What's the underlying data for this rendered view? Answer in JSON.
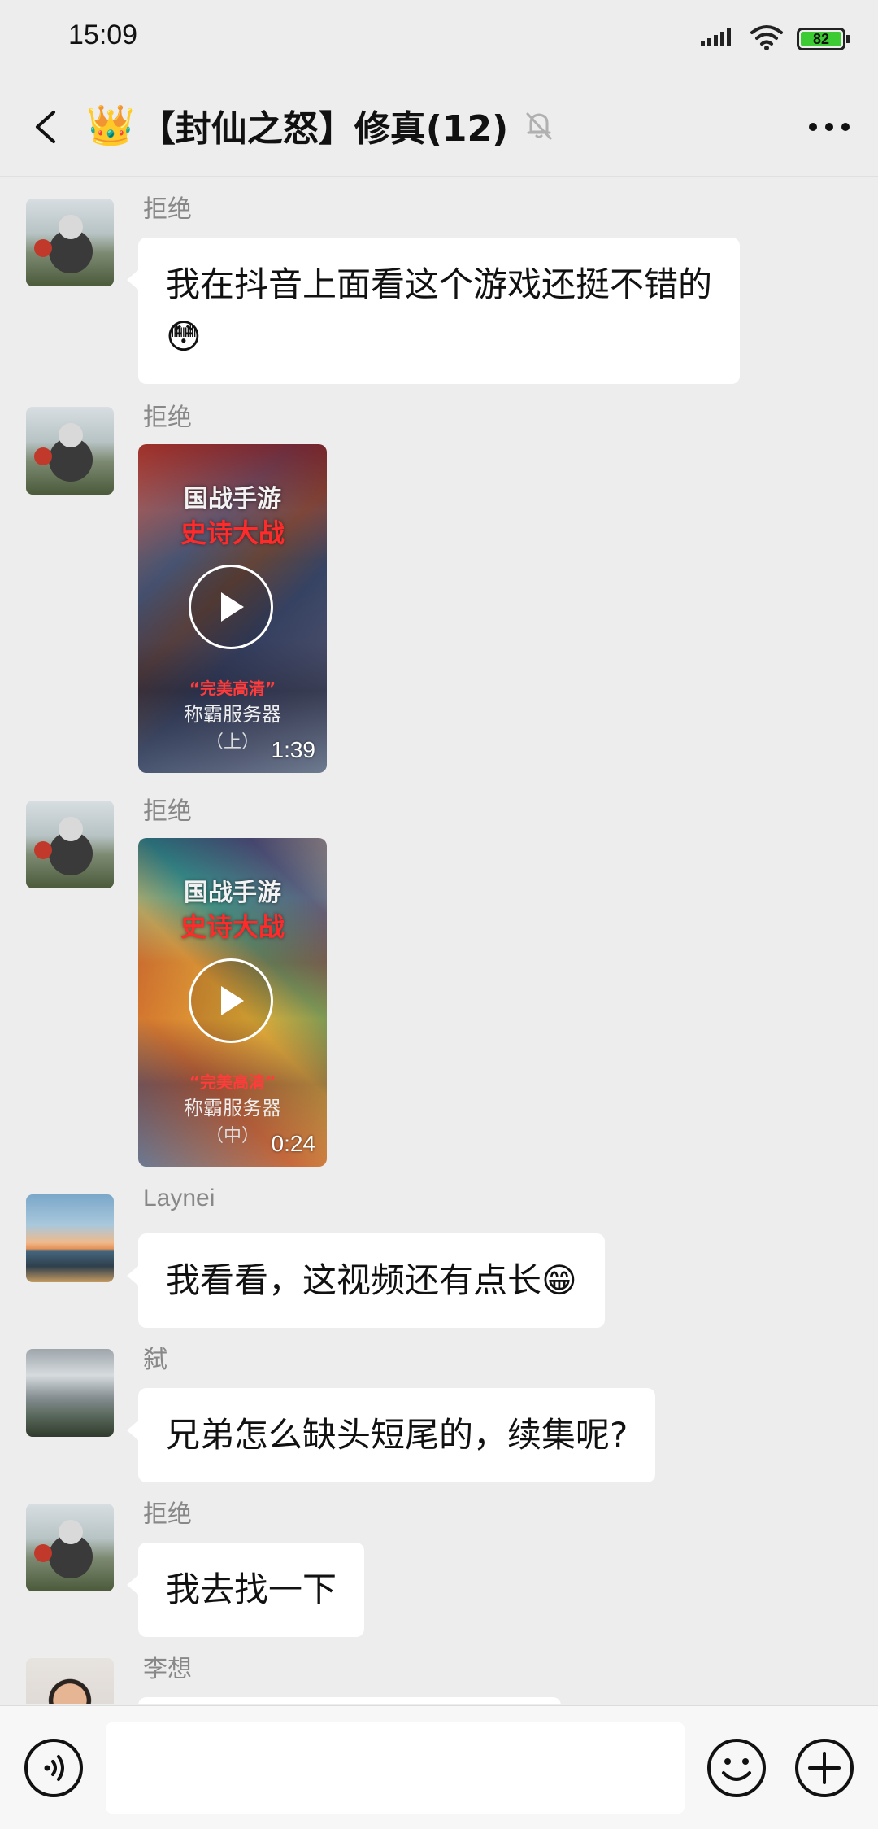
{
  "status_bar": {
    "time": "15:09",
    "battery": "82",
    "icons": [
      "signal-icon",
      "wifi-icon",
      "battery-icon"
    ]
  },
  "nav": {
    "crown_emoji": "👑",
    "title": "【封仙之怒】修真(12)",
    "icons": [
      "back-arrow-icon",
      "muted-bell-icon",
      "more-icon"
    ]
  },
  "messages": [
    {
      "sender": "拒绝",
      "type": "text",
      "text": "我在抖音上面看这个游戏还挺不错的😳"
    },
    {
      "sender": "拒绝",
      "type": "video",
      "video": {
        "title_line1": "国战手游",
        "title_line2": "史诗大战",
        "caption_line1": "“完美高清”",
        "caption_line2": "称霸服务器",
        "caption_line3": "（上）",
        "duration": "1:39"
      }
    },
    {
      "sender": "拒绝",
      "type": "video",
      "video": {
        "title_line1": "国战手游",
        "title_line2": "史诗大战",
        "caption_line1": "“完美高清”",
        "caption_line2": "称霸服务器",
        "caption_line3": "（中）",
        "duration": "0:24"
      }
    },
    {
      "sender": "Laynei",
      "type": "text",
      "text": "我看看，这视频还有点长😁"
    },
    {
      "sender": "弑",
      "type": "text",
      "text": "兄弟怎么缺头短尾的，续集呢?"
    },
    {
      "sender": "拒绝",
      "type": "text",
      "text": "我去找一下"
    },
    {
      "sender": "李想",
      "type": "text",
      "text": ""
    }
  ],
  "input_bar": {
    "value": "",
    "icons": [
      "voice-icon",
      "emoji-icon",
      "plus-icon"
    ]
  },
  "colors": {
    "background": "#ededed",
    "bubble": "#ffffff",
    "battery": "#3ccb33",
    "video_title_accent": "#ff2a2a",
    "sender_text": "#888888"
  }
}
